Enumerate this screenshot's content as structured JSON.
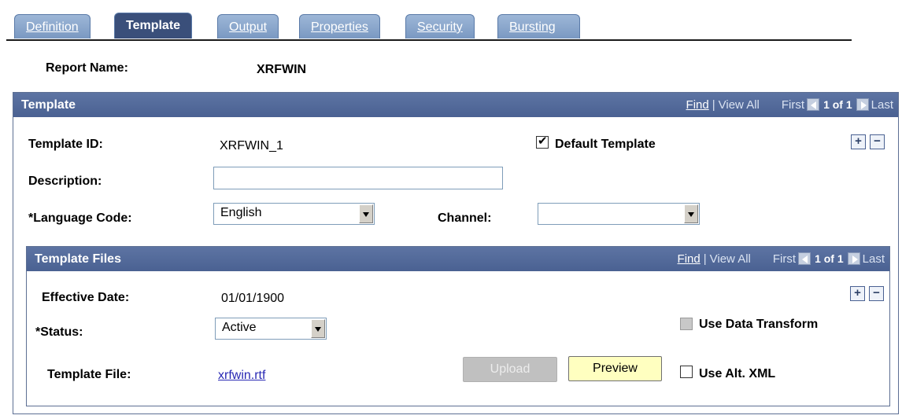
{
  "tabs": [
    {
      "label": "Definition"
    },
    {
      "label": "Template"
    },
    {
      "label": "Output"
    },
    {
      "label": "Properties"
    },
    {
      "label": "Security"
    },
    {
      "label": "Bursting"
    }
  ],
  "active_tab": "Template",
  "report": {
    "label": "Report Name:",
    "value": "XRFWIN"
  },
  "template_section": {
    "title": "Template",
    "nav": {
      "find": "Find",
      "separator": "|",
      "view_all": "View All",
      "first": "First",
      "count": "1 of 1",
      "last": "Last"
    },
    "template_id": {
      "label": "Template ID:",
      "value": "XRFWIN_1"
    },
    "default_template": {
      "label": "Default Template",
      "checked": true
    },
    "description": {
      "label": "Description:",
      "value": ""
    },
    "language_code": {
      "label": "*Language Code:",
      "value": "English"
    },
    "channel": {
      "label": "Channel:",
      "value": ""
    },
    "add_row": "+",
    "delete_row": "−"
  },
  "template_files": {
    "title": "Template Files",
    "nav": {
      "find": "Find",
      "separator": "|",
      "view_all": "View All",
      "first": "First",
      "count": "1 of 1",
      "last": "Last"
    },
    "effective_date": {
      "label": "Effective Date:",
      "value": "01/01/1900"
    },
    "status": {
      "label": "*Status:",
      "value": "Active"
    },
    "use_data_transform": {
      "label": "Use Data Transform",
      "checked": false,
      "disabled": true
    },
    "template_file": {
      "label": "Template File:",
      "value": "xrfwin.rtf"
    },
    "upload_button": "Upload",
    "preview_button": "Preview",
    "use_alt_xml": {
      "label": "Use Alt. XML",
      "checked": false
    },
    "add_row": "+",
    "delete_row": "−"
  },
  "colors": {
    "header_bg": "#4a6192",
    "tab_active": "#3a4f7a",
    "tab_inactive": "#8aa6cc",
    "link": "#2828b4",
    "preview_bg": "#ffffc0"
  }
}
